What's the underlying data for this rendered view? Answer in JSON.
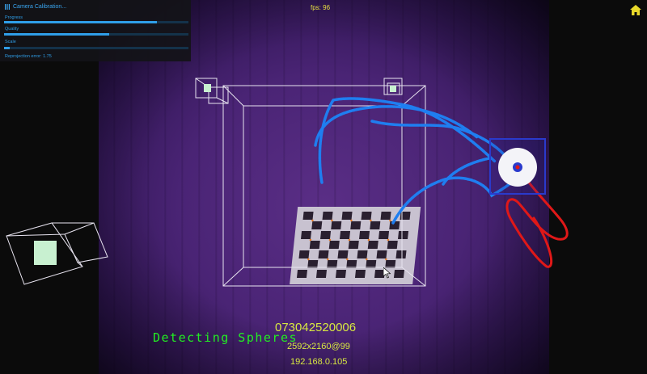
{
  "panel": {
    "title": "Camera Calibration...",
    "rows": [
      {
        "label": "Progress",
        "value": 0.83
      },
      {
        "label": "Quality",
        "value": 0.57
      },
      {
        "label": "Scale",
        "value": 0.03
      }
    ],
    "reprojection": "Reprojection error: 1.75"
  },
  "header": {
    "fps": "fps: 96"
  },
  "camera": {
    "status": "Detecting Spheres",
    "serial": "073042520006",
    "resolution": "2592x2160@99",
    "ip": "192.168.0.105"
  },
  "colors": {
    "accent": "#2f9ee8",
    "overlay_text": "#d8e840",
    "status_text": "#22ee22",
    "trail_blue": "#1f7ef0",
    "trail_red": "#e01818",
    "feed": "#4a2475"
  },
  "icons": [
    "menu-icon",
    "home-icon",
    "cursor-icon"
  ]
}
